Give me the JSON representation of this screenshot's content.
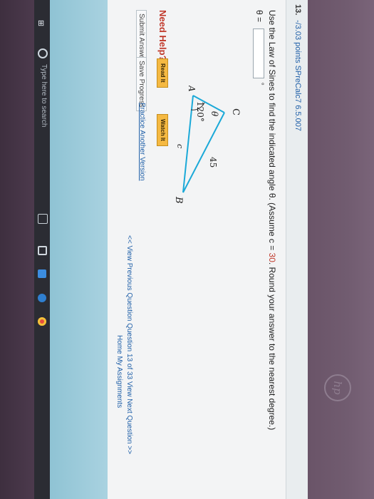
{
  "question": {
    "number": "13.",
    "points_label": "-/3.03 points  SPreCalc7 6.5.007",
    "prompt_pre": "Use the Law of Sines to find the indicated angle θ. (Assume c = ",
    "prompt_c": "30",
    "prompt_post": ". Round your answer to the nearest degree.)",
    "answer_label": "θ =",
    "answer_value": "",
    "degree_symbol": "°"
  },
  "figure": {
    "vertex_c": "C",
    "vertex_a": "A",
    "vertex_b": "B",
    "angle_theta": "θ",
    "angle_120": "120°",
    "side_45": "45",
    "side_c": "c"
  },
  "help": {
    "need_help": "Need Help?",
    "read_it": "Read It",
    "watch_it": "Watch It"
  },
  "actions": {
    "submit": "Submit Answer",
    "save": "Save Progress",
    "practice": "Practice Another Version"
  },
  "nav": {
    "text": "<< View Previous Question  Question 13 of 33  View Next Question >>",
    "home": "Home  My Assignments"
  },
  "taskbar": {
    "search_placeholder": "Type here to search"
  },
  "brand": {
    "logo": "hp"
  }
}
